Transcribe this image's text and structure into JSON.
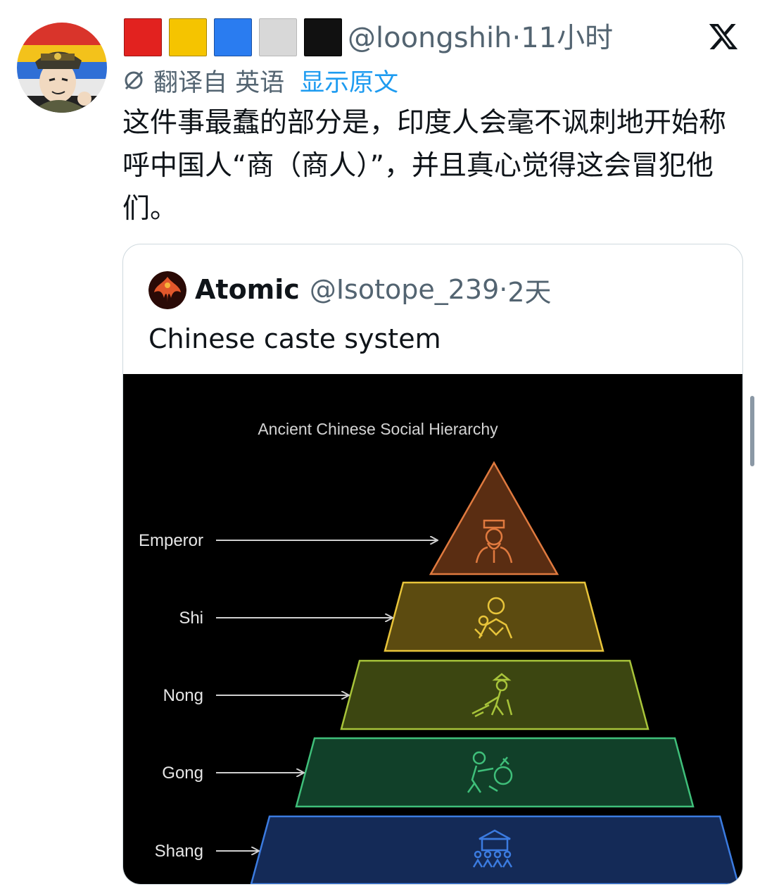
{
  "tweet": {
    "handle": "@loongshih",
    "separator": "·",
    "time": "11小时",
    "translated_from": "翻译自 英语",
    "show_original": "显示原文",
    "text": "这件事最蠢的部分是，印度人会毫不讽刺地开始称呼中国人“商（商人）”，并且真心觉得这会冒犯他们。",
    "flag_colors": [
      "#e2221f",
      "#f5c400",
      "#2a7cf0",
      "#d8d8d8",
      "#111111"
    ]
  },
  "quote": {
    "name": "Atomic",
    "handle": "@Isotope_239",
    "separator": "·",
    "time": "2天",
    "text": "Chinese caste system"
  },
  "diagram": {
    "title": "Ancient Chinese Social Hierarchy",
    "levels": [
      {
        "label": "Emperor",
        "color": "#e07a3f",
        "icon": "emperor-icon"
      },
      {
        "label": "Shi",
        "color": "#e8c43a",
        "icon": "scholar-icon"
      },
      {
        "label": "Nong",
        "color": "#a8c43a",
        "icon": "farmer-icon"
      },
      {
        "label": "Gong",
        "color": "#3fbf7a",
        "icon": "artisan-icon"
      },
      {
        "label": "Shang",
        "color": "#3b7be0",
        "icon": "merchant-icon"
      }
    ]
  }
}
